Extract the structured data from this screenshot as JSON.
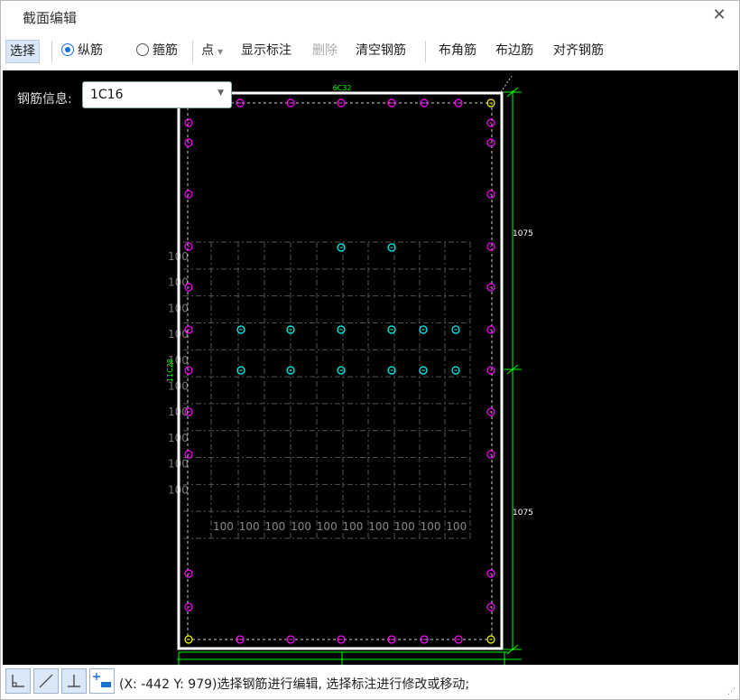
{
  "window": {
    "title": "截面编辑"
  },
  "toolbar": {
    "select_label": "选择",
    "longitudinal_label": "纵筋",
    "stirrup_label": "箍筋",
    "point_label": "点",
    "show_label_label": "显示标注",
    "delete_label": "删除",
    "clear_label": "清空钢筋",
    "corner_label": "布角筋",
    "edge_label": "布边筋",
    "align_label": "对齐钢筋"
  },
  "rebar_info": {
    "label": "钢筋信息:",
    "value": "1C16"
  },
  "drawing": {
    "top_bar_label": "6C32",
    "left_bar_label": "11C28",
    "dim_upper": "1075",
    "dim_lower": "1075",
    "grid_label": "100",
    "colors": {
      "outline": "#ffffff",
      "dimension": "#00ff00",
      "bar_magenta": "#ff00ff",
      "bar_cyan": "#00ffff",
      "bar_yellow": "#ffff00",
      "grid": "#555555"
    }
  },
  "status": {
    "text": "(X: -442 Y: 979)选择钢筋进行编辑, 选择标注进行修改或移动;"
  }
}
